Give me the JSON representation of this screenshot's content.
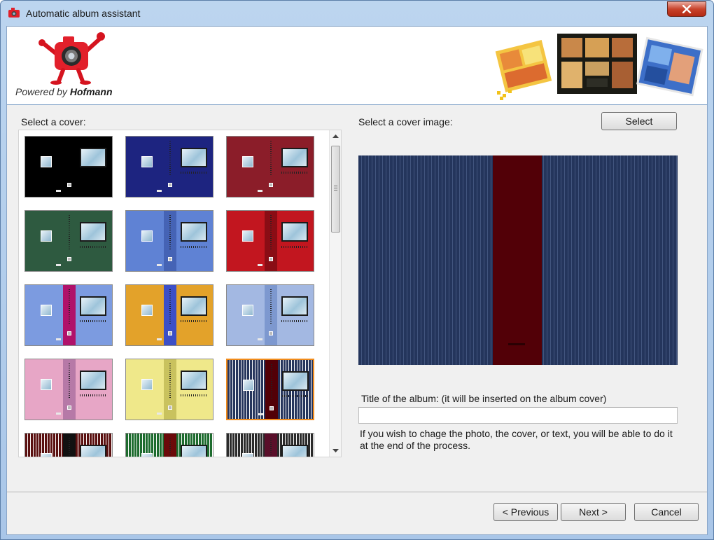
{
  "window": {
    "title": "Automatic album assistant"
  },
  "banner": {
    "powered_by": "Powered by",
    "brand": "Hofmann"
  },
  "left_panel": {
    "label": "Select a cover:",
    "selected_index": 11
  },
  "right_panel": {
    "label": "Select a cover image:",
    "select_button": "Select",
    "title_label": "Title of the album: (it will be inserted on the album cover)",
    "title_value": "",
    "hint": "If you wish to chage the photo, the cover, or text, you will be able to do it at the end of the process."
  },
  "footer": {
    "previous": "< Previous",
    "next": "Next >",
    "cancel": "Cancel"
  },
  "covers": [
    {
      "bg": "#000000",
      "spine": ""
    },
    {
      "bg": "#1d2480",
      "spine": "#1d2480"
    },
    {
      "bg": "#8b1d29",
      "spine": "#8b1d29"
    },
    {
      "bg": "#2e5a40",
      "spine": "#2e5a40"
    },
    {
      "bg": "#5f82d4",
      "spine": "#4563b5"
    },
    {
      "bg": "#c2161f",
      "spine": "#8a0d15"
    },
    {
      "bg": "#7c9be0",
      "spine": "#b0126a"
    },
    {
      "bg": "#e3a22a",
      "spine": "#3c4fc7"
    },
    {
      "bg": "#a3b8e2",
      "spine": "#7d98cf"
    },
    {
      "bg": "#e7a6c6",
      "spine": "#b679a7"
    },
    {
      "bg": "#efe88a",
      "spine": "#c9c25e"
    },
    {
      "bg": "#26355c",
      "spine": "#520007",
      "striped": true
    },
    {
      "bg": "#5a1010",
      "spine": "#111111",
      "striped": true
    },
    {
      "bg": "#1d6b2e",
      "spine": "#6b0a0a",
      "striped": true
    },
    {
      "bg": "#2a2a2a",
      "spine": "#5a0f2a",
      "striped": true
    }
  ],
  "colors": {
    "selection": "#f08b1b",
    "preview_bg": "#24355c",
    "preview_spine": "#520007"
  }
}
